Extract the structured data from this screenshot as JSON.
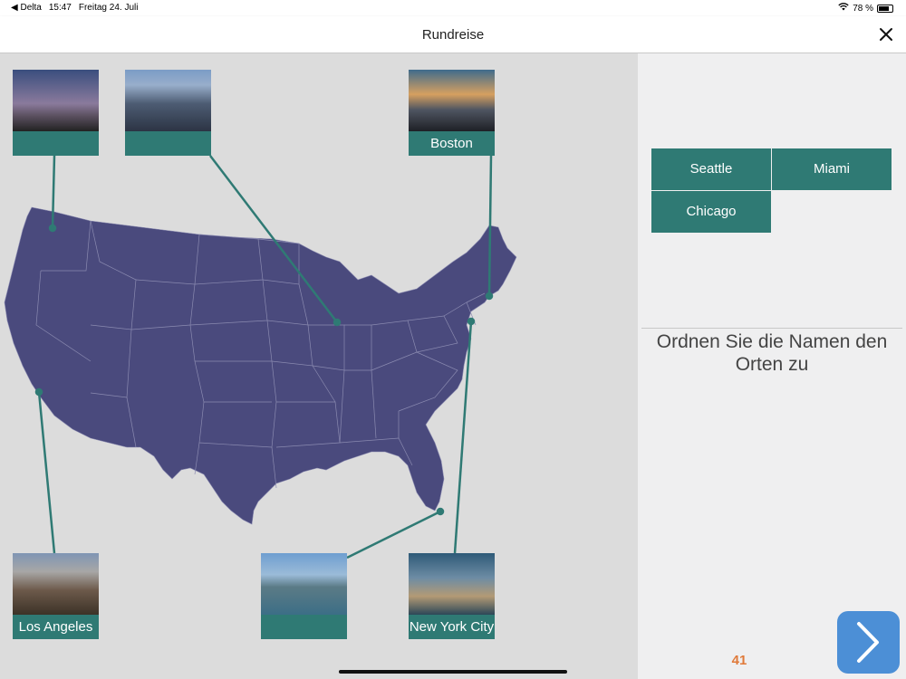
{
  "status_bar": {
    "back_app": "◀ Delta",
    "time": "15:47",
    "date": "Freitag 24. Juli",
    "wifi_icon": "wifi-icon",
    "battery_text": "78 %",
    "battery_level": 0.78
  },
  "nav": {
    "title": "Rundreise",
    "close_icon": "close-icon"
  },
  "map": {
    "fill_color": "#4a4a7d",
    "state_border_color": "#8a8ab0",
    "connector_color": "#2f7a74"
  },
  "cards": [
    {
      "id": "seattle",
      "label": ""
    },
    {
      "id": "chicago",
      "label": ""
    },
    {
      "id": "boston",
      "label": "Boston"
    },
    {
      "id": "los-angeles",
      "label": "Los Angeles"
    },
    {
      "id": "miami",
      "label": ""
    },
    {
      "id": "new-york",
      "label": "New York City"
    }
  ],
  "answer_chips": [
    "Seattle",
    "Miami",
    "Chicago"
  ],
  "instruction": "Ordnen Sie die Namen den Orten zu",
  "counter": "41",
  "next_icon": "chevron-right-icon",
  "colors": {
    "accent_teal": "#2f7a74",
    "next_blue": "#4c8fd6",
    "counter_orange": "#e07a3a"
  }
}
